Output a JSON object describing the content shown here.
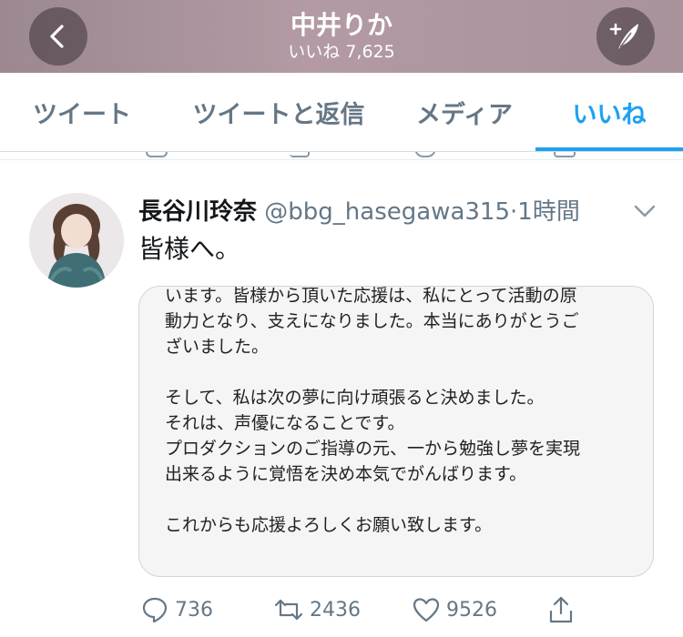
{
  "header": {
    "title": "中井りか",
    "subtitle": "いいね 7,625"
  },
  "tabs": [
    {
      "label": "ツイート"
    },
    {
      "label": "ツイートと返信"
    },
    {
      "label": "メディア"
    },
    {
      "label": "いいね",
      "active": true
    }
  ],
  "tweet": {
    "display_name": "長谷川玲奈",
    "handle": "@bbg_hasegawa315",
    "time": "·1時間",
    "text": "皆様へ。",
    "image_lines": [
      "います。皆様から頂いた応援は、私にとって活動の原",
      "動力となり、支えになりました。本当にありがとうご",
      "ざいました。",
      "",
      "そして、私は次の夢に向け頑張ると決めました。",
      "それは、声優になることです。",
      "プロダクションのご指導の元、一から勉強し夢を実現",
      "出来るように覚悟を決め本気でがんばります。",
      "",
      "これからも応援よろしくお願い致します。"
    ],
    "reply_count": "736",
    "retweet_count": "2436",
    "like_count": "9526"
  },
  "colors": {
    "accent": "#1da1f2",
    "muted": "#657786"
  },
  "icons": [
    "back-icon",
    "compose-icon",
    "chevron-down-icon",
    "reply-icon",
    "retweet-icon",
    "like-icon",
    "share-icon"
  ]
}
